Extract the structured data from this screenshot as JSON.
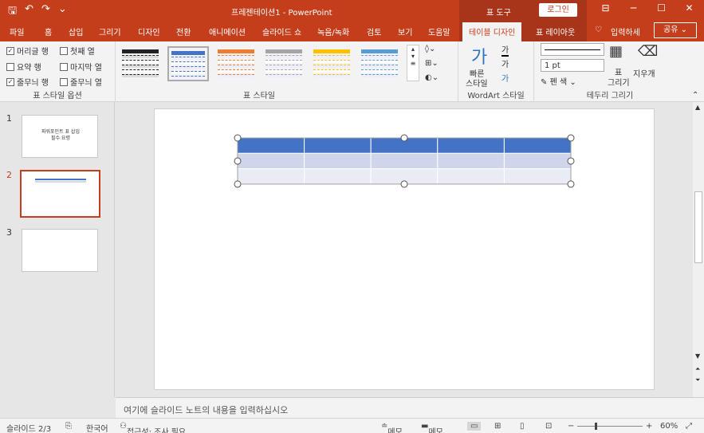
{
  "titlebar": {
    "save_icon": "save-icon",
    "undo_icon": "undo-icon",
    "redo_icon": "redo-icon",
    "title": "프레젠테이션1  -  PowerPoint",
    "context_label": "표 도구",
    "login": "로그인",
    "ribbon_display_icon": "ribbon-display-icon",
    "minimize_icon": "minimize-icon",
    "maximize_icon": "maximize-icon",
    "close_icon": "close-icon"
  },
  "tabs": {
    "file": "파일",
    "home": "홈",
    "insert": "삽입",
    "draw": "그리기",
    "design": "디자인",
    "transitions": "전환",
    "animations": "애니메이션",
    "slideshow": "슬라이드 쇼",
    "record": "녹음/녹화",
    "review": "검토",
    "view": "보기",
    "help": "도움말",
    "table_design": "테이블 디자인",
    "table_layout": "표 레이아웃",
    "tell_me": "입력하세",
    "share": "공유"
  },
  "options": {
    "header_row": "머리글 행",
    "first_col": "첫째 열",
    "total_row": "요약 행",
    "last_col": "마지막 열",
    "banded_rows": "줄무늬 행",
    "banded_cols": "줄무늬 열",
    "group_label": "표 스타일 옵션",
    "header_row_checked": "✓",
    "banded_rows_checked": "✓"
  },
  "styles": {
    "group_label": "표 스타일",
    "swatch_colors": [
      "#222222",
      "#4472c4",
      "#ed7d31",
      "#a5a5a5",
      "#ffc000",
      "#5b9bd5"
    ],
    "shading_icon": "shading-icon",
    "borders_icon": "borders-icon",
    "effects_icon": "effects-icon"
  },
  "wordart": {
    "quick_styles_line1": "빠른",
    "quick_styles_line2": "스타일",
    "group_label": "WordArt 스타일",
    "quick_glyph": "가",
    "text_fill_glyph": "가",
    "text_outline_glyph": "가",
    "text_effect_glyph": "가"
  },
  "borders": {
    "pen_weight": "1 pt",
    "pen_color": "펜 색",
    "draw_table_line1": "표",
    "draw_table_line2": "그리기",
    "eraser": "지우개",
    "group_label": "테두리 그리기"
  },
  "slides": {
    "num1": "1",
    "num2": "2",
    "num3": "3",
    "thumb1_text": "파워포인트 표 삽입\n필수 요령"
  },
  "notes_placeholder": "여기에 슬라이드 노트의 내용을 입력하십시오",
  "status": {
    "slide_count": "슬라이드 2/3",
    "language": "한국어",
    "accessibility": "접근성: 조사 필요",
    "notes": "메모",
    "comments": "메모",
    "zoom": "60%"
  },
  "colors": {
    "accent": "#c43e1c",
    "header_fill": "#4472c4",
    "band_dark": "#cfd5ea",
    "band_light": "#e9ebf5"
  },
  "table": {
    "rows": 3,
    "cols": 5
  }
}
